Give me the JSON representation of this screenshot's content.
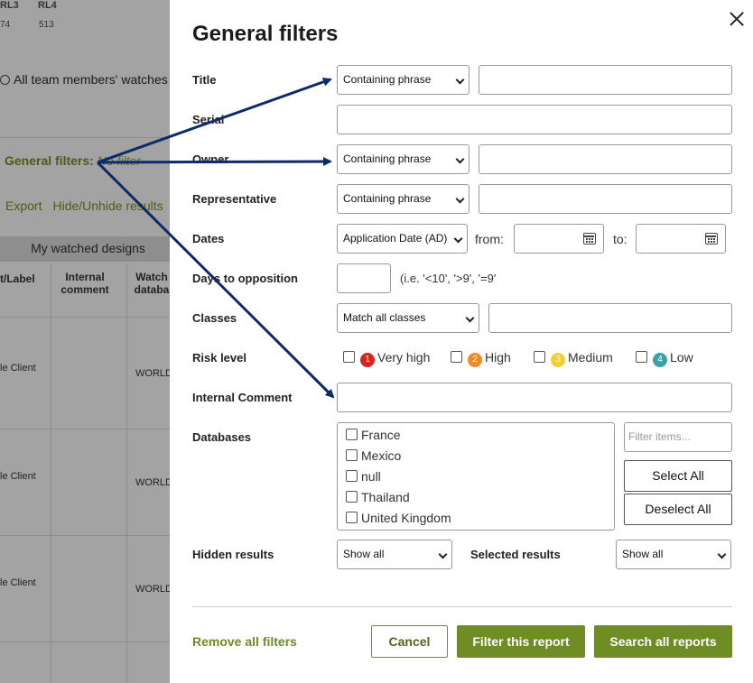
{
  "background": {
    "rl3_label": "RL3",
    "rl3_value": "74",
    "rl4_label": "RL4",
    "rl4_value": "513",
    "watch_scope_option": "All team members' watches",
    "general_filters_label": "General filters:",
    "general_filters_value": "No filter",
    "export_link": "Export",
    "hide_link": "Hide/Unhide results",
    "section_title": "My watched designs",
    "col_label": "t/Label",
    "col_internal": "Internal comment",
    "col_watch": "Watch databa",
    "row_client": "le Client",
    "row_db": "WORLD"
  },
  "modal": {
    "title": "General filters",
    "fields": {
      "title_label": "Title",
      "title_mode": "Containing phrase",
      "serial_label": "Serial",
      "owner_label": "Owner",
      "owner_mode": "Containing phrase",
      "rep_label": "Representative",
      "rep_mode": "Containing phrase",
      "dates_label": "Dates",
      "dates_mode": "Application Date (AD)",
      "from_label": "from:",
      "to_label": "to:",
      "days_label": "Days to opposition",
      "days_hint": "(i.e. '<10', '>9', '=9'",
      "classes_label": "Classes",
      "classes_mode": "Match all classes",
      "risk_label": "Risk level",
      "comment_label": "Internal Comment",
      "databases_label": "Databases",
      "filter_placeholder": "Filter items...",
      "select_all": "Select All",
      "deselect_all": "Deselect All",
      "hidden_label": "Hidden results",
      "hidden_value": "Show all",
      "selected_label": "Selected results",
      "selected_value": "Show all"
    },
    "risk_levels": [
      {
        "num": "1",
        "name": "Very high",
        "color": "#d9241c"
      },
      {
        "num": "2",
        "name": "High",
        "color": "#ef8a25"
      },
      {
        "num": "3",
        "name": "Medium",
        "color": "#f3cf2e"
      },
      {
        "num": "4",
        "name": "Low",
        "color": "#3aa1a6"
      }
    ],
    "databases": [
      "France",
      "Mexico",
      "null",
      "Thailand",
      "United Kingdom"
    ],
    "footer": {
      "remove_all": "Remove all filters",
      "cancel": "Cancel",
      "filter_report": "Filter this report",
      "search_all": "Search all reports"
    }
  },
  "colors": {
    "accent": "#6f8c25",
    "arrow": "#0f2a6b"
  }
}
